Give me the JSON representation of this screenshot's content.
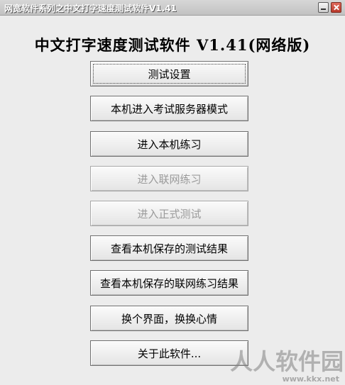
{
  "window": {
    "title": "网宽软件系列之中文打字速度测试软件V1.41",
    "minimize_icon": "minimize-icon",
    "close_icon": "close-icon"
  },
  "heading": "中文打字速度测试软件 V1.41(网络版)",
  "buttons": [
    {
      "label": "测试设置",
      "enabled": true
    },
    {
      "label": "本机进入考试服务器模式",
      "enabled": true
    },
    {
      "label": "进入本机练习",
      "enabled": true
    },
    {
      "label": "进入联网练习",
      "enabled": false
    },
    {
      "label": "进入正式测试",
      "enabled": false
    },
    {
      "label": "查看本机保存的测试结果",
      "enabled": true
    },
    {
      "label": "查看本机保存的联网练习结果",
      "enabled": true
    },
    {
      "label": "换个界面，换换心情",
      "enabled": true
    },
    {
      "label": "关于此软件...",
      "enabled": true
    }
  ],
  "watermark": {
    "text": "人人软件园",
    "url": "www.kkx.net"
  }
}
